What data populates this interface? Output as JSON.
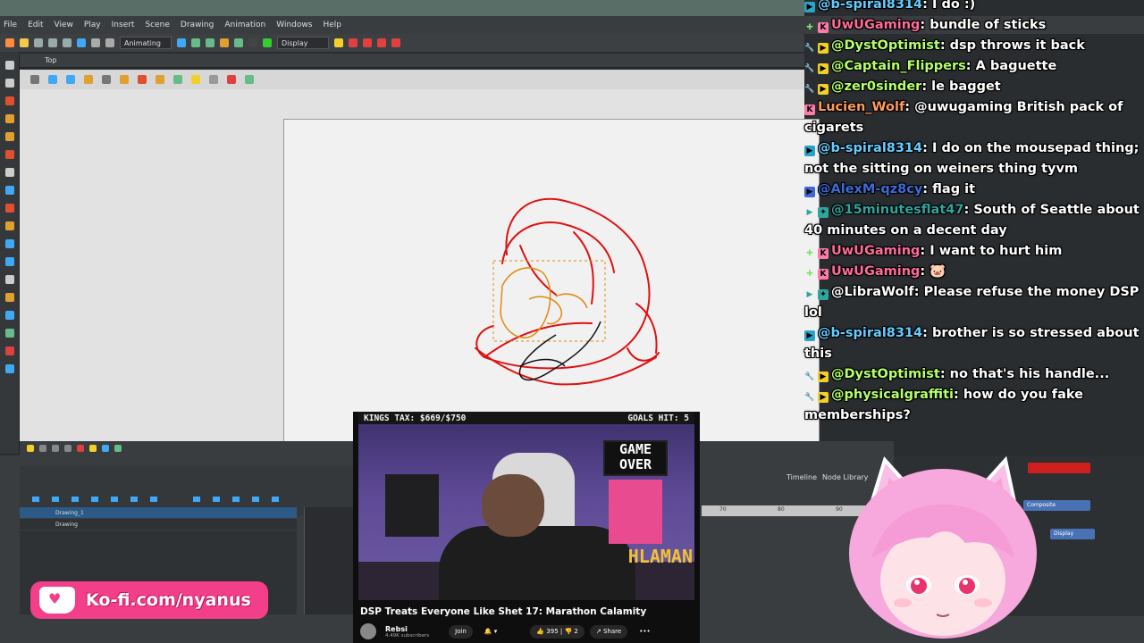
{
  "app": {
    "menu": [
      "File",
      "Edit",
      "View",
      "Play",
      "Insert",
      "Scene",
      "Drawing",
      "Animation",
      "Windows",
      "Help"
    ],
    "toolbar": {
      "mode_select": "Animating",
      "display_select": "Display"
    },
    "camera_tab": "Top",
    "layers": [
      {
        "name": "Drawing_1",
        "selected": true
      },
      {
        "name": "Drawing",
        "selected": false
      }
    ],
    "timeline": {
      "tab_timeline": "Timeline",
      "tab_node_library": "Node Library",
      "ruler_marks": [
        "70",
        "80",
        "90"
      ]
    },
    "nodes": {
      "composite": "Composite",
      "display": "Display"
    }
  },
  "chat": [
    {
      "user": "@b-spiral8314",
      "msg": " I do :)",
      "color": "#66ccff",
      "badge": "yt",
      "badge_color": "#29a3c7"
    },
    {
      "user": "UwUGaming",
      "msg": " bundle of sticks",
      "color": "#ff6b9a",
      "badge": "k",
      "badge_color": "#ff7aa8",
      "badge2": "sparkle"
    },
    {
      "user": "@DystOptimist",
      "msg": " dsp throws it back",
      "color": "#b4ff6a",
      "badge": "yt",
      "badge_color": "#f2d027",
      "badge2": "wrench"
    },
    {
      "user": "@Captain_Flippers",
      "msg": " A baguette",
      "color": "#b4ff6a",
      "badge": "yt",
      "badge_color": "#f2d027",
      "badge2": "wrench"
    },
    {
      "user": "@zer0sinder",
      "msg": " le bagget",
      "color": "#b4ff6a",
      "badge": "yt",
      "badge_color": "#f2d027",
      "badge2": "wrench"
    },
    {
      "user": "Lucien_Wolf",
      "msg": " @uwugaming British pack of cigarets",
      "color": "#ff9a5a",
      "badge": "k",
      "badge_color": "#ff7aa8"
    },
    {
      "user": "@b-spiral8314",
      "msg": " I do on the mousepad thing; not the sitting on weiners thing tyvm",
      "color": "#66ccff",
      "badge": "yt",
      "badge_color": "#29a3c7"
    },
    {
      "user": "@AlexM-qz8cy",
      "msg": " flag it",
      "color": "#3b6bd6",
      "badge": "yt",
      "badge_color": "#3b6bd6"
    },
    {
      "user": "@15minutesflat47",
      "msg": " South of Seattle about 40 minutes on a decent day",
      "color": "#2fa59c",
      "badge": "star",
      "badge_color": "#2fa59c",
      "badge2": "yt"
    },
    {
      "user": "UwUGaming",
      "msg": " I want to hurt him",
      "color": "#ff6b9a",
      "badge": "k",
      "badge_color": "#ff7aa8",
      "badge2": "sparkle"
    },
    {
      "user": "UwUGaming",
      "msg": " 🐷",
      "color": "#ff6b9a",
      "badge": "k",
      "badge_color": "#ff7aa8",
      "badge2": "sparkle"
    },
    {
      "user": "@LibraWolf",
      "msg": " Please refuse the money DSP lol",
      "color": "#ffffff",
      "badge": "star",
      "badge_color": "#2fa59c",
      "badge2": "yt"
    },
    {
      "user": "@b-spiral8314",
      "msg": " brother is so stressed about this",
      "color": "#66ccff",
      "badge": "yt",
      "badge_color": "#29a3c7"
    },
    {
      "user": "@DystOptimist",
      "msg": " no that's his handle...",
      "color": "#b4ff6a",
      "badge": "yt",
      "badge_color": "#f2d027",
      "badge2": "wrench"
    },
    {
      "user": "@physicalgraffiti",
      "msg": " how do you fake memberships?",
      "color": "#b4ff6a",
      "badge": "yt",
      "badge_color": "#f2d027",
      "badge2": "wrench"
    }
  ],
  "video": {
    "kings_tax": "KINGS TAX: $669/$750",
    "goals_hit": "GOALS HIT: 5",
    "game_over": "GAME OVER",
    "banner": "HLAMAN",
    "title": "DSP Treats Everyone Like Shet 17: Marathon Calamity",
    "channel": "Rebsi",
    "subscribers": "4.49K subscribers",
    "join_label": "Join",
    "likes": "395",
    "dislikes": "2",
    "share_label": "Share"
  },
  "kofi": {
    "text": "Ko-fi.com/nyanus"
  },
  "colors": {
    "kofi_pink": "#f33f8a",
    "sketch_red": "#e01010",
    "sketch_orange": "#e08a10"
  }
}
